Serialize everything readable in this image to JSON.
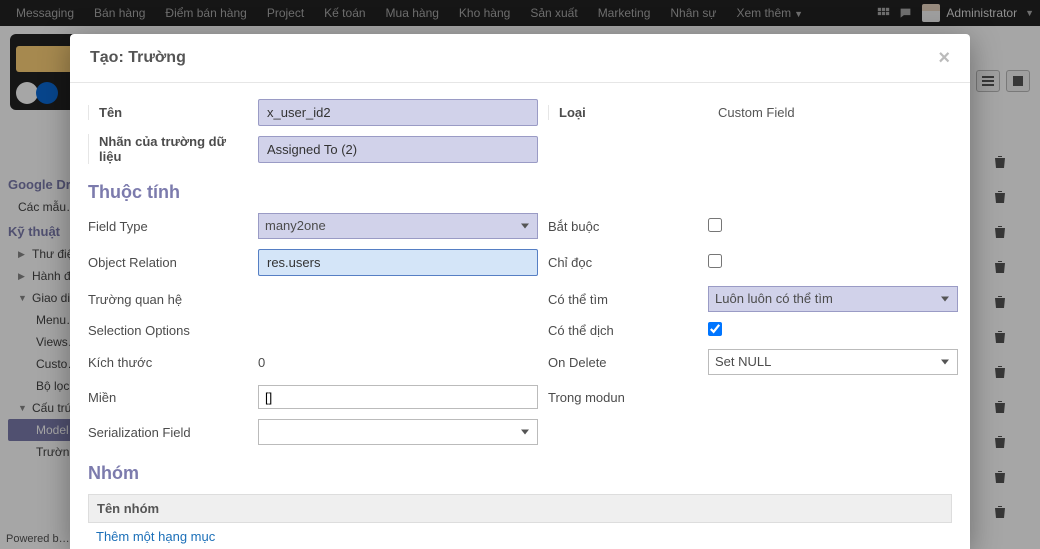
{
  "menubar": {
    "items": [
      "Messaging",
      "Bán hàng",
      "Điểm bán hàng",
      "Project",
      "Kế toán",
      "Mua hàng",
      "Kho hàng",
      "Sản xuất",
      "Marketing",
      "Nhân sự",
      "Xem thêm"
    ],
    "admin": "Administrator"
  },
  "sidebar": {
    "googleDrive": "Google Dr…",
    "templates": "Các mẫu…",
    "kythuat": "Kỹ thuật",
    "items": [
      "Thư điện…",
      "Hành độn…",
      "Giao diện…"
    ],
    "sub": [
      "Menu…",
      "Views…",
      "Custo…",
      "Bộ lọc…"
    ],
    "cautruc": "Cấu trúc…",
    "model": "Model…",
    "truong": "Trườn…"
  },
  "modal": {
    "title": "Tạo: Trường",
    "labels": {
      "ten": "Tên",
      "nhan": "Nhãn của trường dữ liệu",
      "loai": "Loại",
      "fieldType": "Field Type",
      "objectRelation": "Object Relation",
      "truongQH": "Trường quan hệ",
      "selOpt": "Selection Options",
      "kichThuoc": "Kích thước",
      "mien": "Miền",
      "serField": "Serialization Field",
      "batBuoc": "Bắt buộc",
      "chiDoc": "Chỉ đọc",
      "coTheTim": "Có thể tìm",
      "coTheDich": "Có thể dịch",
      "onDelete": "On Delete",
      "trongModun": "Trong modun"
    },
    "values": {
      "ten": "x_user_id2",
      "nhan": "Assigned To (2)",
      "loai": "Custom Field",
      "fieldType": "many2one",
      "objectRelation": "res.users",
      "kichThuoc": "0",
      "mien": "[]",
      "coTheTim": "Luôn luôn có thể tìm",
      "onDelete": "Set NULL"
    },
    "sections": {
      "thuocTinh": "Thuộc tính",
      "nhom": "Nhóm"
    },
    "table": {
      "tenNhom": "Tên nhóm",
      "addRow": "Thêm một hạng mục"
    },
    "checkboxes": {
      "batBuoc": false,
      "chiDoc": false,
      "coTheDich": true
    }
  },
  "footer": "Powered b…"
}
